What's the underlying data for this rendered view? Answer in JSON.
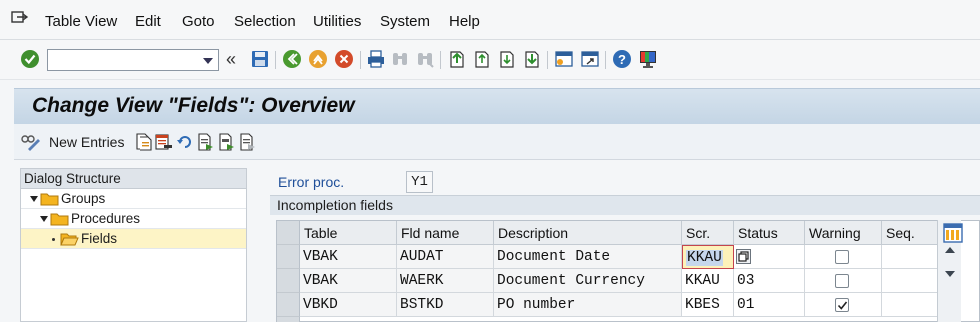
{
  "menubar": {
    "items": [
      "Table View",
      "Edit",
      "Goto",
      "Selection",
      "Utilities",
      "System",
      "Help"
    ]
  },
  "toolbar": {
    "command_field_value": "",
    "raquo": "«"
  },
  "title": "Change View \"Fields\": Overview",
  "app_toolbar": {
    "new_entries": "New Entries"
  },
  "dialog_structure": {
    "header": "Dialog Structure",
    "nodes": [
      {
        "label": "Groups",
        "level": 0,
        "expanded": true
      },
      {
        "label": "Procedures",
        "level": 1,
        "expanded": true
      },
      {
        "label": "Fields",
        "level": 2,
        "selected": true
      }
    ]
  },
  "filter": {
    "label": "Error proc.",
    "value": "Y1"
  },
  "section_header": "Incompletion fields",
  "table": {
    "columns": [
      "Table",
      "Fld name",
      "Description",
      "Scr.",
      "Status",
      "Warning",
      "Seq."
    ],
    "rows": [
      {
        "table": "VBAK",
        "field": "AUDAT",
        "description": "Document Date",
        "screen": "KKAU",
        "status": "",
        "warning": false,
        "seq": ""
      },
      {
        "table": "VBAK",
        "field": "WAERK",
        "description": "Document Currency",
        "screen": "KKAU",
        "status": "03",
        "warning": false,
        "seq": ""
      },
      {
        "table": "VBKD",
        "field": "BSTKD",
        "description": "PO number",
        "screen": "KBES",
        "status": "01",
        "warning": true,
        "seq": ""
      }
    ]
  },
  "colors": {
    "title_bg": "#c9d9e8",
    "label_blue": "#1f4f99",
    "selected_row": "#fdf4c6",
    "focus_border": "#c4444e"
  }
}
